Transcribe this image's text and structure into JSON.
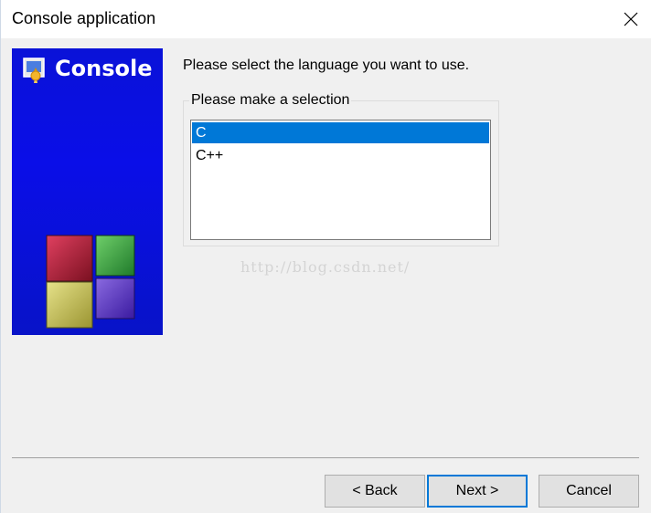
{
  "window": {
    "title": "Console application",
    "close_icon": "close-icon"
  },
  "banner": {
    "title": "Console",
    "icon": "wizard-app-icon",
    "colors": {
      "background": "#0a12d8",
      "text": "#ffffff"
    }
  },
  "main": {
    "prompt": "Please select the language you want to use.",
    "group_label": "Please make a selection",
    "languages": [
      {
        "label": "C",
        "selected": true
      },
      {
        "label": "C++",
        "selected": false
      }
    ],
    "watermark": "http://blog.csdn.net/"
  },
  "footer": {
    "back_label": "< Back",
    "next_label": "Next >",
    "cancel_label": "Cancel"
  },
  "colors": {
    "selection": "#0078d7",
    "default_button_border": "#0078d7"
  }
}
